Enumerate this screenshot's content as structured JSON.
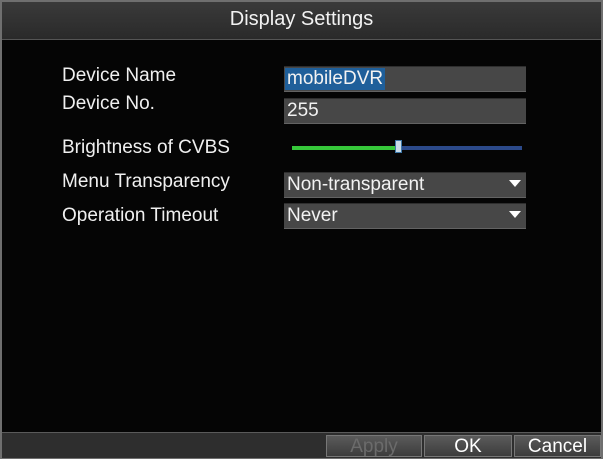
{
  "window": {
    "title": "Display Settings"
  },
  "fields": [
    {
      "label": "Device Name",
      "value": "mobileDVR",
      "type": "text"
    },
    {
      "label": "Device No.",
      "value": "255",
      "type": "text"
    },
    {
      "label": "Brightness of CVBS",
      "type": "slider",
      "level": 0.46
    },
    {
      "label": "Menu Transparency",
      "value": "Non-transparent",
      "type": "dropdown"
    },
    {
      "label": "Operation Timeout",
      "value": "Never",
      "type": "dropdown"
    }
  ],
  "buttons": {
    "apply": "Apply",
    "ok": "OK",
    "cancel": "Cancel"
  },
  "colors": {
    "selection": "#1f5f9a",
    "slider_fill": "#36c83a",
    "slider_track": "#2c4a8a",
    "disabled_text": "#6b6b6b"
  },
  "icons": {
    "dropdown": "dropdown-arrow-icon",
    "slider_handle": "slider-thumb-icon"
  }
}
